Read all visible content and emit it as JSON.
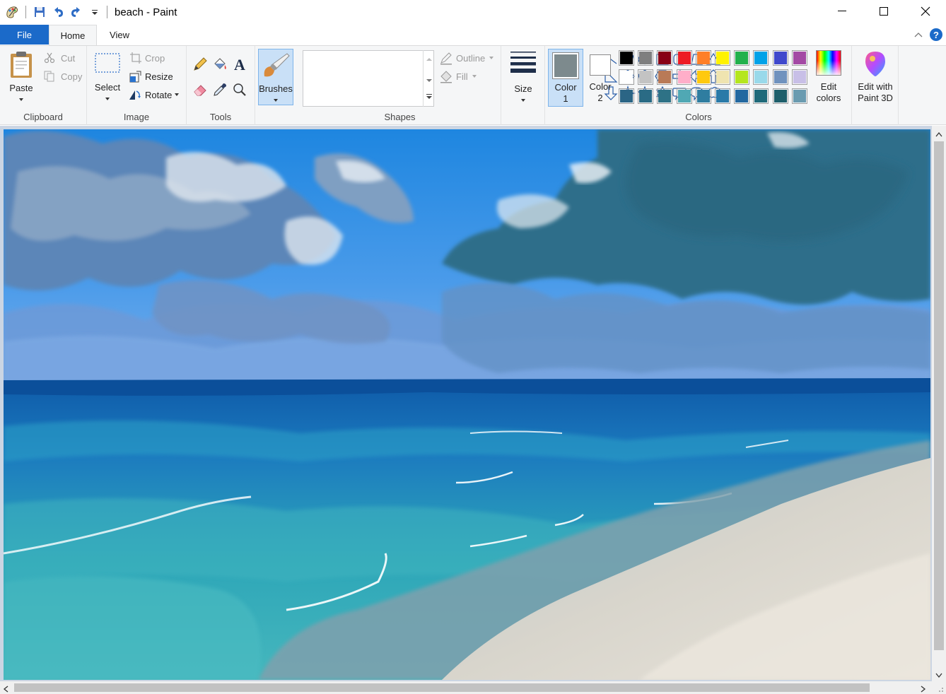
{
  "window": {
    "title": "beach - Paint",
    "controls": {
      "minimize": "minimize-icon",
      "maximize": "maximize-icon",
      "close": "close-icon"
    }
  },
  "quick_access": {
    "icons": [
      "paint-app-icon",
      "save-icon",
      "undo-icon",
      "redo-icon",
      "customize-toolbar-icon"
    ]
  },
  "tabs": {
    "file": "File",
    "home": "Home",
    "view": "View"
  },
  "ribbon": {
    "clipboard": {
      "group_label": "Clipboard",
      "paste": "Paste",
      "cut": "Cut",
      "copy": "Copy"
    },
    "image": {
      "group_label": "Image",
      "select": "Select",
      "crop": "Crop",
      "resize": "Resize",
      "rotate": "Rotate"
    },
    "tools": {
      "group_label": "Tools",
      "items": [
        "pencil-icon",
        "fill-bucket-icon",
        "text-icon",
        "eraser-icon",
        "color-picker-icon",
        "magnifier-icon"
      ]
    },
    "brushes": {
      "label": "Brushes"
    },
    "shapes": {
      "group_label": "Shapes",
      "outline": "Outline",
      "fill": "Fill"
    },
    "size": {
      "label": "Size"
    },
    "colors": {
      "group_label": "Colors",
      "color1_label": "Color",
      "color1_num": "1",
      "color2_label": "Color",
      "color2_num": "2",
      "color1": "#7d8a8d",
      "color2": "#ffffff",
      "edit_colors_line1": "Edit",
      "edit_colors_line2": "colors",
      "paint3d_line1": "Edit with",
      "paint3d_line2": "Paint 3D",
      "palette_row1": [
        "#000000",
        "#7f7f7f",
        "#880015",
        "#ed1c24",
        "#ff7f27",
        "#fff200",
        "#22b14c",
        "#00a2e8",
        "#3f48cc",
        "#a349a4"
      ],
      "palette_row2": [
        "#ffffff",
        "#c3c3c3",
        "#b97a57",
        "#ffaec9",
        "#ffc90e",
        "#efe4b0",
        "#b5e61d",
        "#99d9ea",
        "#7092be",
        "#c8bfe7"
      ],
      "palette_row3": [
        "#2b6585",
        "#2a6b85",
        "#2e7286",
        "#50a8b4",
        "#2f7da0",
        "#2a7aa8",
        "#2368a0",
        "#1f6a7a",
        "#1e5f6b",
        "#6a9bb0"
      ]
    }
  },
  "canvas": {
    "image": "beach painting"
  }
}
